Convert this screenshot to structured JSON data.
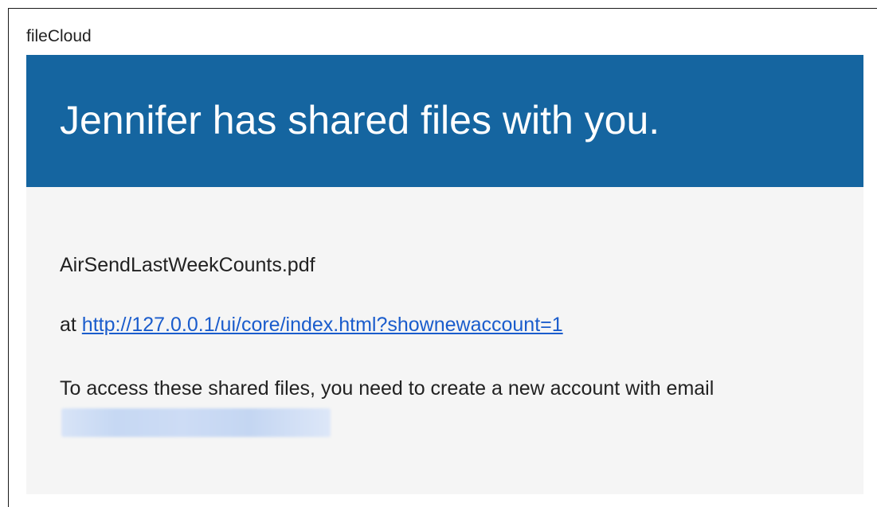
{
  "email": {
    "sender_name": "fileCloud",
    "banner_title": "Jennifer has shared files with you.",
    "file_name": "AirSendLastWeekCounts.pdf",
    "link_prefix": "at ",
    "link_text": "http://127.0.0.1/ui/core/index.html?shownewaccount=1",
    "access_message": "To access these shared files, you need to create a new account with email"
  },
  "colors": {
    "banner_background": "#1565a0",
    "content_background": "#f5f5f5",
    "link": "#1a5ccc"
  }
}
